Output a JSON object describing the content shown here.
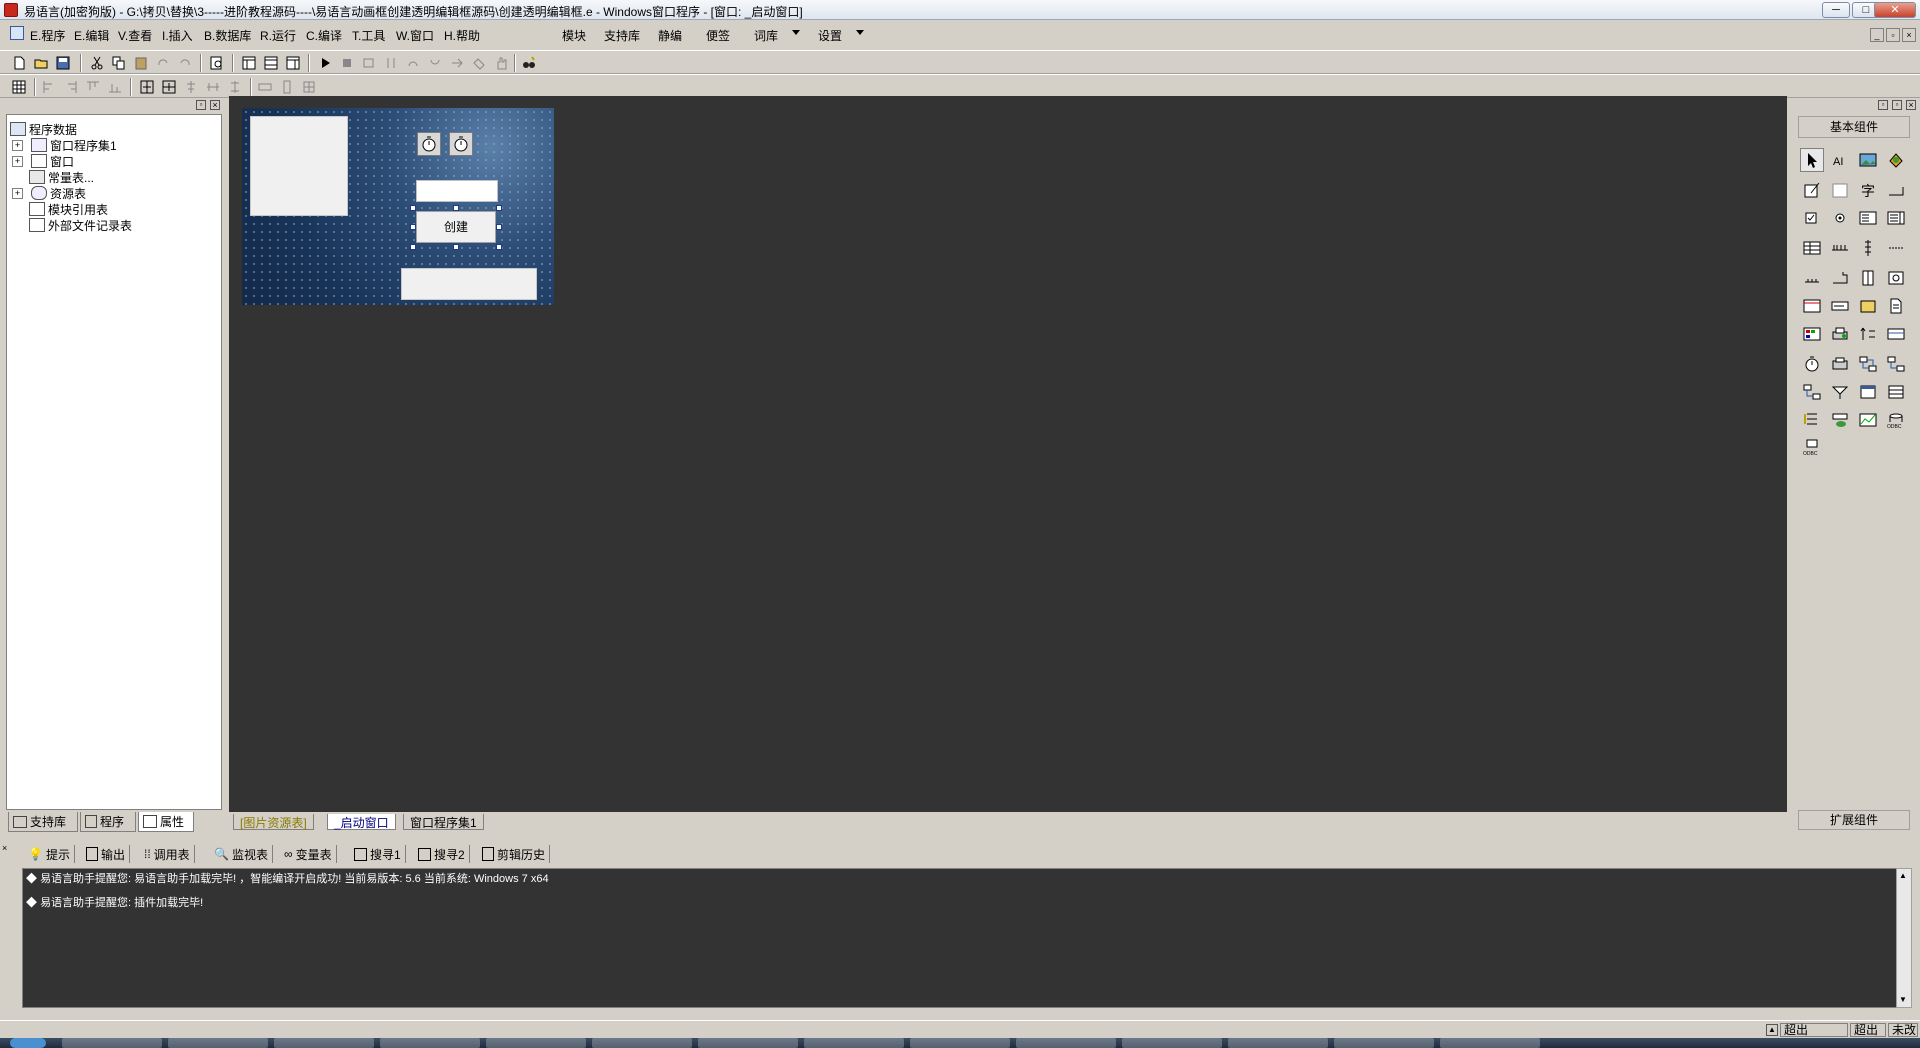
{
  "window": {
    "title": "易语言(加密狗版) - G:\\拷贝\\替换\\3-----进阶教程源码----\\易语言动画框创建透明编辑框源码\\创建透明编辑框.e - Windows窗口程序 - [窗口: _启动窗口]",
    "min_label": "─",
    "max_label": "□",
    "close_label": "✕"
  },
  "menubar": {
    "items": [
      "E.程序",
      "E.编辑",
      "V.查看",
      "I.插入",
      "B.数据库",
      "R.运行",
      "C.编译",
      "T.工具",
      "W.窗口",
      "H.帮助"
    ],
    "extras": [
      "模块",
      "支持库",
      "静编",
      "便签",
      "词库",
      "设置"
    ]
  },
  "left_panel": {
    "tree": [
      {
        "label": "程序数据",
        "level": 0
      },
      {
        "label": "窗口程序集1",
        "level": 1,
        "expandable": true
      },
      {
        "label": "窗口",
        "level": 1,
        "expandable": true
      },
      {
        "label": "常量表...",
        "level": 1
      },
      {
        "label": "资源表",
        "level": 1,
        "expandable": true
      },
      {
        "label": "模块引用表",
        "level": 1
      },
      {
        "label": "外部文件记录表",
        "level": 1
      }
    ],
    "tabs": [
      "支持库",
      "程序",
      "属性"
    ]
  },
  "form": {
    "create_button": "创建"
  },
  "workspace_tabs": [
    "[图片资源表]",
    "_启动窗口",
    "窗口程序集1"
  ],
  "right_panel": {
    "header": "基本组件",
    "footer": "扩展组件",
    "odbc_label": "ODBC"
  },
  "output_tabs": [
    "提示",
    "输出",
    "调用表",
    "监视表",
    "变量表",
    "搜寻1",
    "搜寻2",
    "剪辑历史"
  ],
  "output_lines": [
    "易语言助手提醒您: 易语言助手加载完毕! ，智能编译开启成功! 当前易版本: 5.6  当前系统: Windows 7 x64",
    "易语言助手提醒您: 插件加载完毕!"
  ],
  "statusbar": {
    "cells": [
      "超出",
      "超出",
      "未改"
    ]
  }
}
